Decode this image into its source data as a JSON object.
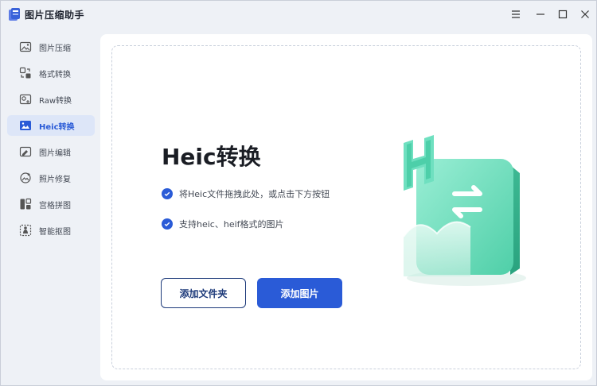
{
  "app": {
    "title": "图片压缩助手"
  },
  "window_controls": [
    "menu-icon",
    "minimize-icon",
    "maximize-icon",
    "close-icon"
  ],
  "sidebar": {
    "items": [
      {
        "label": "图片压缩",
        "icon": "image-compress-icon",
        "active": false
      },
      {
        "label": "格式转换",
        "icon": "format-convert-icon",
        "active": false
      },
      {
        "label": "Raw转换",
        "icon": "raw-convert-icon",
        "active": false
      },
      {
        "label": "Heic转换",
        "icon": "heic-convert-icon",
        "active": true
      },
      {
        "label": "图片编辑",
        "icon": "image-edit-icon",
        "active": false
      },
      {
        "label": "照片修复",
        "icon": "photo-repair-icon",
        "active": false
      },
      {
        "label": "宫格拼图",
        "icon": "grid-collage-icon",
        "active": false
      },
      {
        "label": "智能抠图",
        "icon": "smart-cutout-icon",
        "active": false
      }
    ]
  },
  "main": {
    "heading": "Heic转换",
    "bullets": [
      "将Heic文件拖拽此处，或点击下方按钮",
      "支持heic、heif格式的图片"
    ],
    "add_folder_label": "添加文件夹",
    "add_image_label": "添加图片"
  },
  "colors": {
    "accent": "#2a5bd7",
    "active_bg": "#dde6f8",
    "illustration_teal": "#5fd8b4"
  }
}
